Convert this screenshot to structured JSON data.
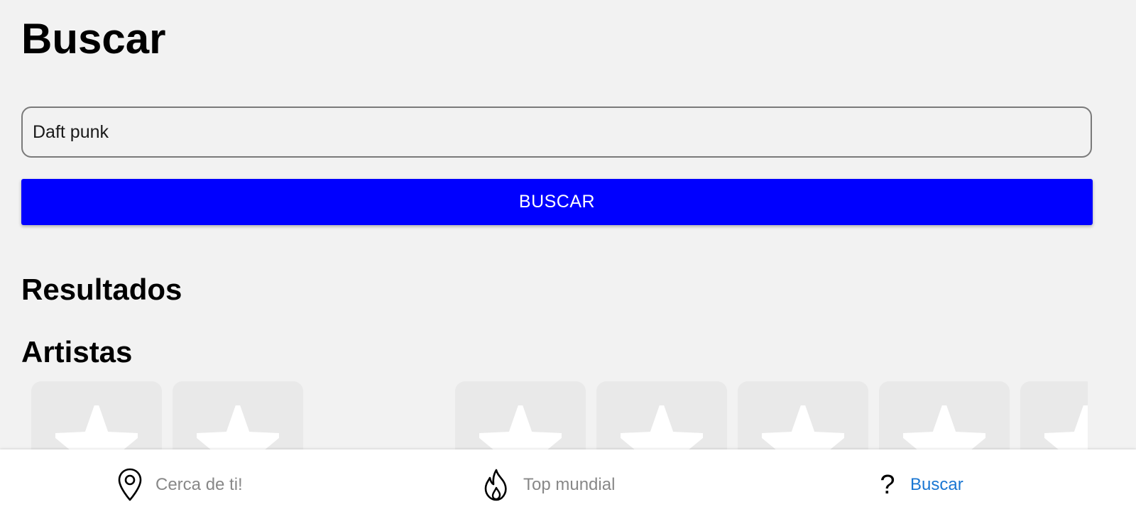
{
  "header": {
    "title": "Buscar"
  },
  "search": {
    "value": "Daft punk",
    "button_label": "BUSCAR"
  },
  "results": {
    "heading": "Resultados",
    "artists_heading": "Artistas",
    "artist_cards": [
      {
        "icon": "star-placeholder-icon"
      },
      {
        "icon": "star-placeholder-icon"
      },
      {
        "icon": "star-placeholder-icon"
      },
      {
        "icon": "star-placeholder-icon"
      },
      {
        "icon": "star-placeholder-icon"
      },
      {
        "icon": "star-placeholder-icon"
      },
      {
        "icon": "star-placeholder-icon"
      }
    ]
  },
  "bottom_nav": {
    "items": [
      {
        "label": "Cerca de ti!",
        "icon": "location-pin-icon",
        "active": false
      },
      {
        "label": "Top mundial",
        "icon": "fire-icon",
        "active": false
      },
      {
        "label": "Buscar",
        "icon": "question-mark-icon",
        "active": true
      }
    ]
  },
  "colors": {
    "background": "#f2f2f2",
    "button": "#0000ff",
    "active_nav": "#1976d2",
    "inactive_nav": "#888888",
    "card": "#e9e9e9"
  }
}
